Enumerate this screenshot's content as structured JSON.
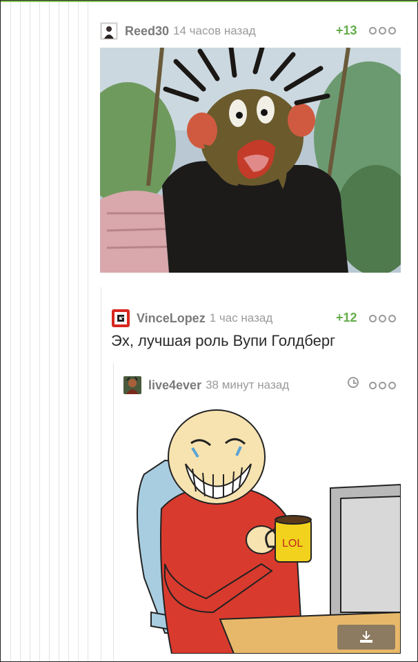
{
  "comments": [
    {
      "username": "Reed30",
      "time": "14 часов назад",
      "rating": "+13",
      "avatar_icon": "user-avatar-icon"
    },
    {
      "username": "VinceLopez",
      "time": "1 час назад",
      "rating": "+12",
      "text": "Эх, лучшая роль Вупи Голдберг",
      "avatar_icon": "red-g-logo-icon"
    },
    {
      "username": "live4ever",
      "time": "38 минут назад",
      "avatar_icon": "character-avatar-icon"
    }
  ],
  "images": {
    "first": {
      "description_icon": "cartoon-character-surprised-image"
    },
    "second": {
      "mug_text": "LOL"
    }
  },
  "colors": {
    "accent_green": "#62ad4a",
    "meta_gray": "#9a9a9a",
    "username_gray": "#7a7a7a",
    "thread_line": "#e3e3e3"
  }
}
